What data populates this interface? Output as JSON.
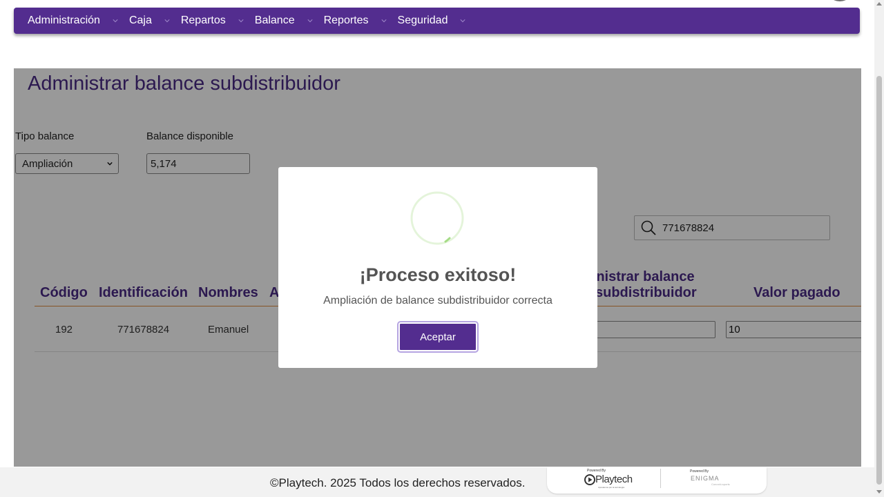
{
  "nav": {
    "items": [
      {
        "label": "Administración"
      },
      {
        "label": "Caja"
      },
      {
        "label": "Repartos"
      },
      {
        "label": "Balance"
      },
      {
        "label": "Reportes"
      },
      {
        "label": "Seguridad"
      }
    ]
  },
  "page": {
    "title": "Administrar balance subdistribuidor",
    "tipo_balance_label": "Tipo balance",
    "tipo_balance_value": "Ampliación",
    "balance_disponible_label": "Balance disponible",
    "balance_disponible_value": "5,174",
    "search_value": "771678824"
  },
  "table": {
    "headers": {
      "codigo": "Código",
      "identificacion": "Identificación",
      "nombres": "Nombres",
      "partial": "A",
      "admin_line1": "ministrar balance",
      "admin_line2": "subdistribuidor",
      "valor_pagado": "Valor pagado"
    },
    "rows": [
      {
        "codigo": "192",
        "identificacion": "771678824",
        "nombres": "Emanuel",
        "admin_value": "",
        "valor_pagado": "10"
      }
    ]
  },
  "modal": {
    "title": "¡Proceso exitoso!",
    "message": "Ampliación de balance subdistribuidor correcta",
    "button": "Aceptar",
    "accent": "#a5dc86"
  },
  "footer": {
    "text": "©Playtech. 2025 Todos los derechos reservados.",
    "powered_by_1": "Powered By",
    "playtech_logo": "Playtech",
    "playtech_tagline": "Apostamos por la tecnología",
    "powered_by_2": "Powered By",
    "enigma_logo": "ENIGMA",
    "enigma_tagline": "Conoció.sports"
  },
  "colors": {
    "brand": "#532d8f",
    "title": "#4a2a86",
    "header_rule": "#e08a3c"
  }
}
